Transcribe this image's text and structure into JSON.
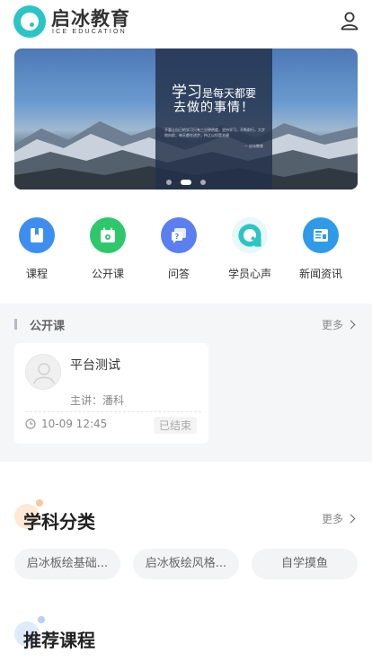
{
  "header": {
    "logo_title": "启冰教育",
    "logo_sub": "ICE EDUCATION"
  },
  "banner": {
    "line1_big": "学习",
    "line1_small": "是每天都要",
    "line2": "去做的事情！",
    "fine_print": "不要让自己的学习只有三分钟热度，坚持学习，不断前行，大步地向前，每天都在进步，持之以恒是关键",
    "signature": "— 启冰教育",
    "slides": 3,
    "active_slide": 1
  },
  "nav": [
    {
      "label": "课程",
      "icon": "book-icon",
      "color": "#3d8ef0"
    },
    {
      "label": "公开课",
      "icon": "calendar-icon",
      "color": "#2ec76b"
    },
    {
      "label": "问答",
      "icon": "chat-question-icon",
      "color": "#5b7ff0"
    },
    {
      "label": "学员心声",
      "icon": "logo-icon",
      "color": "#2ac5c4"
    },
    {
      "label": "新闻资讯",
      "icon": "news-icon",
      "color": "#2f9be8"
    }
  ],
  "open_course": {
    "title": "公开课",
    "more": "更多",
    "card": {
      "name": "平台测试",
      "host": "主讲：潘科",
      "time": "10-09 12:45",
      "status": "已结束"
    }
  },
  "subjects": {
    "title": "学科分类",
    "more": "更多",
    "items": [
      "启冰板绘基础...",
      "启冰板绘风格...",
      "自学摸鱼"
    ]
  },
  "recommend": {
    "title": "推荐课程"
  },
  "colors": {
    "brand": "#2ac5c4"
  }
}
